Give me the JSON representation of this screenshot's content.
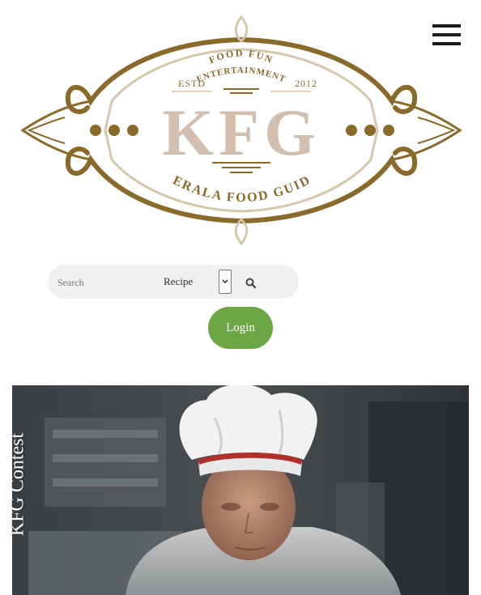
{
  "header": {
    "menu_icon": "hamburger-menu-icon"
  },
  "logo": {
    "top_text_1": "FOOD FUN",
    "top_text_2": "ENTERTAINMENT",
    "estd_label": "ESTD",
    "estd_year": "2012",
    "monogram": "KFG",
    "bottom_text": "KERALA FOOD GUIDE",
    "colors": {
      "primary": "#8a6a2a",
      "secondary": "#d2bfb0",
      "line": "#d4c7aa"
    }
  },
  "search": {
    "placeholder": "Search",
    "category_selected": "Recipe",
    "search_icon": "search-icon"
  },
  "login": {
    "label": "Login",
    "color": "#6da745"
  },
  "hero": {
    "title": "KFG Contest"
  }
}
